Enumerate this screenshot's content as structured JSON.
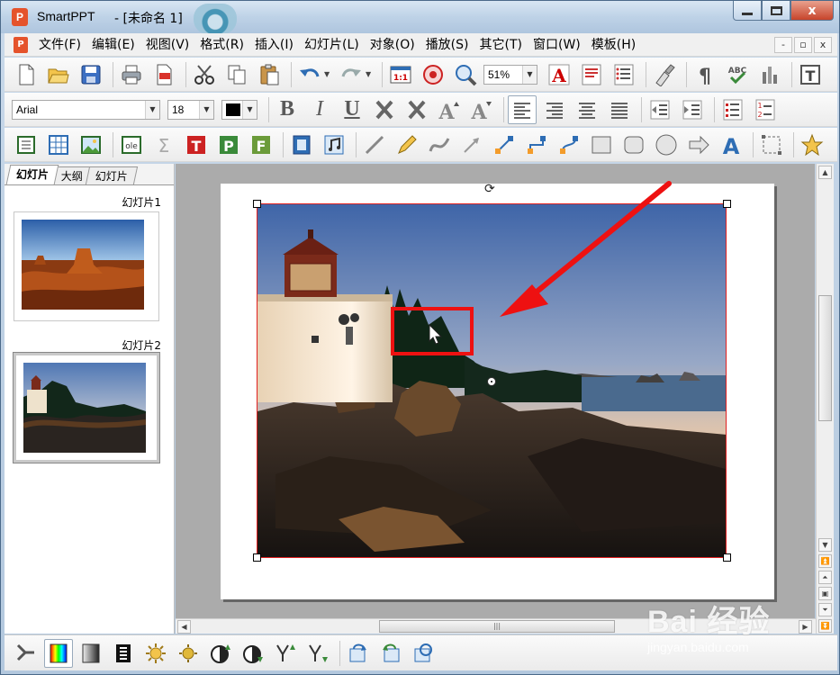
{
  "window": {
    "app_name": "SmartPPT",
    "doc_title": "- [未命名 1]",
    "app_icon_letter": "P",
    "close_glyph": "x"
  },
  "menu": {
    "items": [
      "文件(F)",
      "编辑(E)",
      "视图(V)",
      "格式(R)",
      "插入(I)",
      "幻灯片(L)",
      "对象(O)",
      "播放(S)",
      "其它(T)",
      "窗口(W)",
      "模板(H)"
    ],
    "mdi_buttons": [
      "-",
      "▫",
      "x"
    ]
  },
  "format_bar": {
    "font": "Arial",
    "size": "18",
    "zoom": "51%",
    "bold": "B",
    "italic": "I",
    "underline": "U"
  },
  "left_panel": {
    "tabs": [
      "幻灯片",
      "大纲",
      "幻灯片"
    ],
    "slides": [
      {
        "label": "幻灯片1"
      },
      {
        "label": "幻灯片2"
      }
    ]
  },
  "colors": {
    "selection_border": "#e02020",
    "annotation_red": "#ee1111",
    "accent": "#2e6db4"
  },
  "watermark": {
    "text": "Bai 经验",
    "url": "jingyan.baidu.com"
  }
}
